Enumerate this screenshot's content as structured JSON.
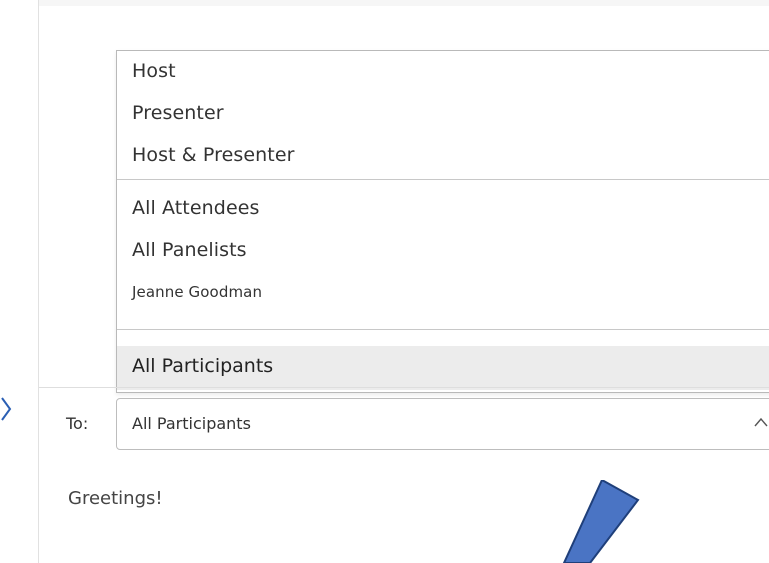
{
  "recipient_menu": {
    "groups": [
      {
        "items": [
          "Host",
          "Presenter",
          "Host & Presenter"
        ]
      },
      {
        "items": [
          "All Attendees",
          "All Panelists",
          "Jeanne Goodman"
        ]
      }
    ],
    "selected_item": "All Participants"
  },
  "compose": {
    "to_label": "To:",
    "to_value": "All Participants",
    "message": "Greetings!"
  },
  "icons": {
    "dropdown_toggle": "chevron-up-icon",
    "annotation": "pointer-arrow-icon"
  },
  "colors": {
    "annotation_fill": "#4a74c4",
    "annotation_stroke": "#1f3f7a",
    "selected_bg": "#ececec"
  }
}
